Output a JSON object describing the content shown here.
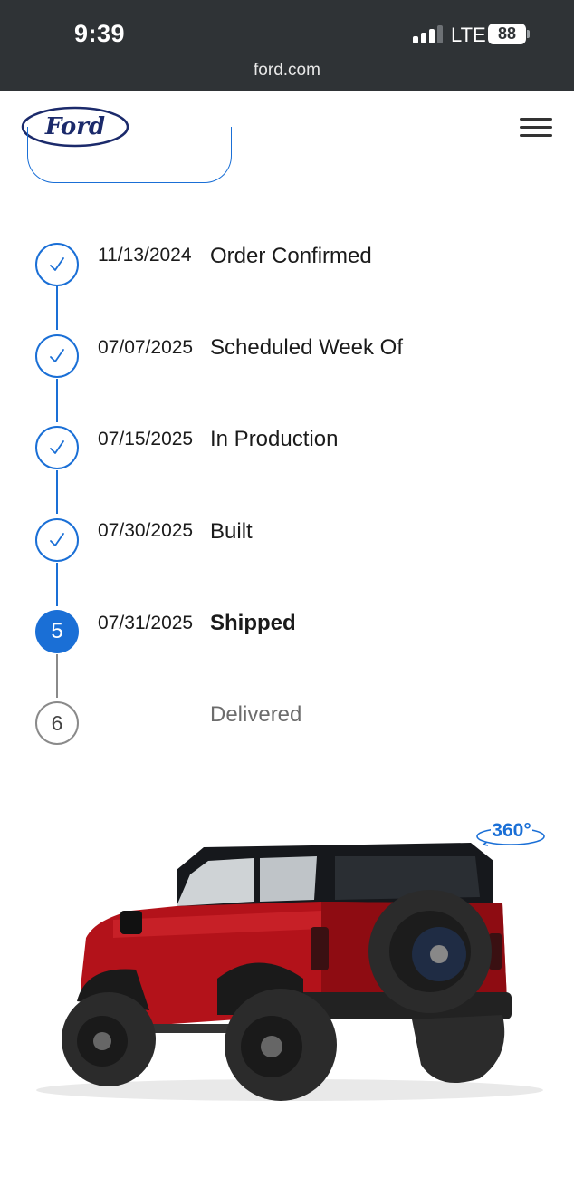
{
  "status_bar": {
    "time": "9:39",
    "network": "LTE",
    "battery": "88"
  },
  "browser": {
    "url": "ford.com"
  },
  "header": {
    "logo_text": "Ford",
    "menu_icon": "hamburger-menu-icon"
  },
  "colors": {
    "accent": "#1a6fd6",
    "text": "#1b1b1b",
    "muted": "#6c6c6c",
    "statusbar": "#2f3336",
    "ford_blue": "#1b2a6b"
  },
  "timeline": {
    "steps": [
      {
        "date": "11/13/2024",
        "label": "Order Confirmed",
        "state": "done"
      },
      {
        "date": "07/07/2025",
        "label": "Scheduled Week Of",
        "state": "done"
      },
      {
        "date": "07/15/2025",
        "label": "In Production",
        "state": "done"
      },
      {
        "date": "07/30/2025",
        "label": "Built",
        "state": "done"
      },
      {
        "number": "5",
        "date": "07/31/2025",
        "label": "Shipped",
        "state": "current"
      },
      {
        "number": "6",
        "date": "",
        "label": "Delivered",
        "state": "upcoming"
      }
    ]
  },
  "vehicle": {
    "view_360_label": "360°"
  }
}
